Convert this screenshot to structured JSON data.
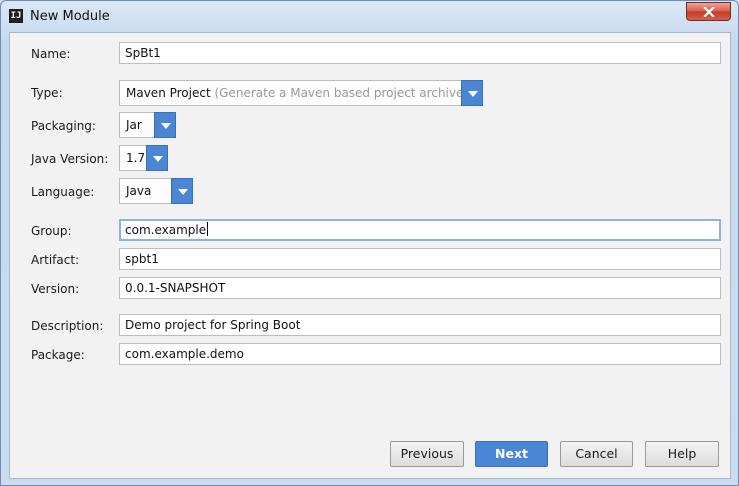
{
  "window": {
    "title": "New Module",
    "app_icon_text": "IJ",
    "close_icon": "close-icon"
  },
  "form": {
    "name": {
      "label": "Name:",
      "value": "SpBt1"
    },
    "type": {
      "label": "Type:",
      "value": "Maven Project",
      "hint": "(Generate a Maven based project archive)"
    },
    "packaging": {
      "label": "Packaging:",
      "value": "Jar"
    },
    "java_version": {
      "label": "Java Version:",
      "value": "1.7"
    },
    "language": {
      "label": "Language:",
      "value": "Java"
    },
    "group": {
      "label": "Group:",
      "value": "com.example"
    },
    "artifact": {
      "label": "Artifact:",
      "value": "spbt1"
    },
    "version": {
      "label": "Version:",
      "value": "0.0.1-SNAPSHOT"
    },
    "description": {
      "label": "Description:",
      "value": "Demo project for Spring Boot"
    },
    "package": {
      "label": "Package:",
      "value": "com.example.demo"
    }
  },
  "buttons": {
    "previous": "Previous",
    "next": "Next",
    "cancel": "Cancel",
    "help": "Help"
  },
  "colors": {
    "accent": "#4a86d3",
    "focus_border": "#8fb2e3",
    "close_red": "#c23a25"
  }
}
